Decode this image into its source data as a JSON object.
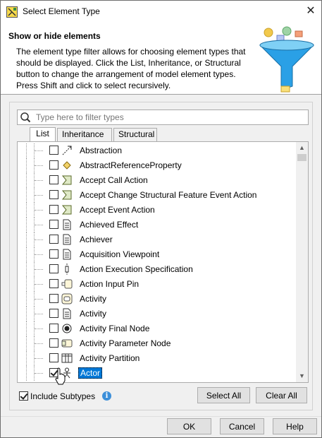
{
  "window": {
    "title": "Select Element Type",
    "close_glyph": "✕"
  },
  "header": {
    "title": "Show or hide elements",
    "description": "The element type filter allows for choosing element types that should be displayed. Click the List, Inheritance, or Structural button to change the arrangement of model element types. Press Shift and click to select recursively."
  },
  "search": {
    "placeholder": "Type here to filter types",
    "value": ""
  },
  "tabs": [
    {
      "label": "List",
      "active": true
    },
    {
      "label": "Inheritance",
      "active": false
    },
    {
      "label": "Structural",
      "active": false
    }
  ],
  "elements": [
    {
      "label": "Abstraction",
      "icon": "abstraction-icon",
      "checked": false,
      "selected": false
    },
    {
      "label": "AbstractReferenceProperty",
      "icon": "diamond-icon",
      "checked": false,
      "selected": false
    },
    {
      "label": "Accept Call Action",
      "icon": "accept-action-icon",
      "checked": false,
      "selected": false
    },
    {
      "label": "Accept Change Structural Feature Event Action",
      "icon": "accept-action-icon",
      "checked": false,
      "selected": false
    },
    {
      "label": "Accept Event Action",
      "icon": "accept-action-icon",
      "checked": false,
      "selected": false
    },
    {
      "label": "Achieved Effect",
      "icon": "document-icon",
      "checked": false,
      "selected": false
    },
    {
      "label": "Achiever",
      "icon": "document-icon",
      "checked": false,
      "selected": false
    },
    {
      "label": "Acquisition Viewpoint",
      "icon": "document-icon",
      "checked": false,
      "selected": false
    },
    {
      "label": "Action Execution Specification",
      "icon": "execution-spec-icon",
      "checked": false,
      "selected": false
    },
    {
      "label": "Action Input Pin",
      "icon": "input-pin-icon",
      "checked": false,
      "selected": false
    },
    {
      "label": "Activity",
      "icon": "activity-icon",
      "checked": false,
      "selected": false
    },
    {
      "label": "Activity",
      "icon": "document-icon",
      "checked": false,
      "selected": false
    },
    {
      "label": "Activity Final Node",
      "icon": "final-node-icon",
      "checked": false,
      "selected": false
    },
    {
      "label": "Activity Parameter Node",
      "icon": "parameter-node-icon",
      "checked": false,
      "selected": false
    },
    {
      "label": "Activity Partition",
      "icon": "partition-icon",
      "checked": false,
      "selected": false
    },
    {
      "label": "Actor",
      "icon": "actor-icon",
      "checked": true,
      "selected": true
    }
  ],
  "include_subtypes": {
    "label": "Include Subtypes",
    "checked": true
  },
  "buttons": {
    "select_all": "Select All",
    "clear_all": "Clear All",
    "ok": "OK",
    "cancel": "Cancel",
    "help": "Help"
  },
  "colors": {
    "selection": "#0078d7",
    "funnel": "#2aa0e6"
  }
}
